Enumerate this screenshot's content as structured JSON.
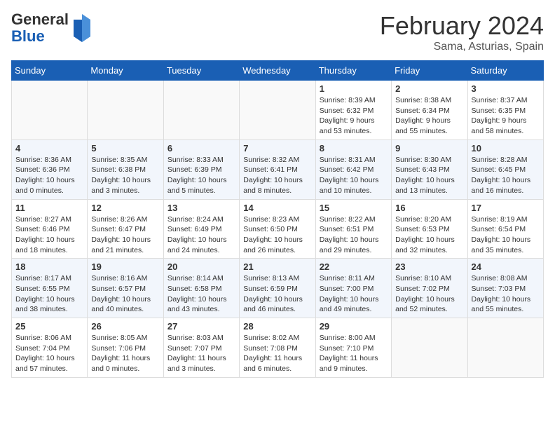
{
  "header": {
    "logo_general": "General",
    "logo_blue": "Blue",
    "month": "February 2024",
    "location": "Sama, Asturias, Spain"
  },
  "weekdays": [
    "Sunday",
    "Monday",
    "Tuesday",
    "Wednesday",
    "Thursday",
    "Friday",
    "Saturday"
  ],
  "weeks": [
    [
      {
        "day": "",
        "info": ""
      },
      {
        "day": "",
        "info": ""
      },
      {
        "day": "",
        "info": ""
      },
      {
        "day": "",
        "info": ""
      },
      {
        "day": "1",
        "info": "Sunrise: 8:39 AM\nSunset: 6:32 PM\nDaylight: 9 hours\nand 53 minutes."
      },
      {
        "day": "2",
        "info": "Sunrise: 8:38 AM\nSunset: 6:34 PM\nDaylight: 9 hours\nand 55 minutes."
      },
      {
        "day": "3",
        "info": "Sunrise: 8:37 AM\nSunset: 6:35 PM\nDaylight: 9 hours\nand 58 minutes."
      }
    ],
    [
      {
        "day": "4",
        "info": "Sunrise: 8:36 AM\nSunset: 6:36 PM\nDaylight: 10 hours\nand 0 minutes."
      },
      {
        "day": "5",
        "info": "Sunrise: 8:35 AM\nSunset: 6:38 PM\nDaylight: 10 hours\nand 3 minutes."
      },
      {
        "day": "6",
        "info": "Sunrise: 8:33 AM\nSunset: 6:39 PM\nDaylight: 10 hours\nand 5 minutes."
      },
      {
        "day": "7",
        "info": "Sunrise: 8:32 AM\nSunset: 6:41 PM\nDaylight: 10 hours\nand 8 minutes."
      },
      {
        "day": "8",
        "info": "Sunrise: 8:31 AM\nSunset: 6:42 PM\nDaylight: 10 hours\nand 10 minutes."
      },
      {
        "day": "9",
        "info": "Sunrise: 8:30 AM\nSunset: 6:43 PM\nDaylight: 10 hours\nand 13 minutes."
      },
      {
        "day": "10",
        "info": "Sunrise: 8:28 AM\nSunset: 6:45 PM\nDaylight: 10 hours\nand 16 minutes."
      }
    ],
    [
      {
        "day": "11",
        "info": "Sunrise: 8:27 AM\nSunset: 6:46 PM\nDaylight: 10 hours\nand 18 minutes."
      },
      {
        "day": "12",
        "info": "Sunrise: 8:26 AM\nSunset: 6:47 PM\nDaylight: 10 hours\nand 21 minutes."
      },
      {
        "day": "13",
        "info": "Sunrise: 8:24 AM\nSunset: 6:49 PM\nDaylight: 10 hours\nand 24 minutes."
      },
      {
        "day": "14",
        "info": "Sunrise: 8:23 AM\nSunset: 6:50 PM\nDaylight: 10 hours\nand 26 minutes."
      },
      {
        "day": "15",
        "info": "Sunrise: 8:22 AM\nSunset: 6:51 PM\nDaylight: 10 hours\nand 29 minutes."
      },
      {
        "day": "16",
        "info": "Sunrise: 8:20 AM\nSunset: 6:53 PM\nDaylight: 10 hours\nand 32 minutes."
      },
      {
        "day": "17",
        "info": "Sunrise: 8:19 AM\nSunset: 6:54 PM\nDaylight: 10 hours\nand 35 minutes."
      }
    ],
    [
      {
        "day": "18",
        "info": "Sunrise: 8:17 AM\nSunset: 6:55 PM\nDaylight: 10 hours\nand 38 minutes."
      },
      {
        "day": "19",
        "info": "Sunrise: 8:16 AM\nSunset: 6:57 PM\nDaylight: 10 hours\nand 40 minutes."
      },
      {
        "day": "20",
        "info": "Sunrise: 8:14 AM\nSunset: 6:58 PM\nDaylight: 10 hours\nand 43 minutes."
      },
      {
        "day": "21",
        "info": "Sunrise: 8:13 AM\nSunset: 6:59 PM\nDaylight: 10 hours\nand 46 minutes."
      },
      {
        "day": "22",
        "info": "Sunrise: 8:11 AM\nSunset: 7:00 PM\nDaylight: 10 hours\nand 49 minutes."
      },
      {
        "day": "23",
        "info": "Sunrise: 8:10 AM\nSunset: 7:02 PM\nDaylight: 10 hours\nand 52 minutes."
      },
      {
        "day": "24",
        "info": "Sunrise: 8:08 AM\nSunset: 7:03 PM\nDaylight: 10 hours\nand 55 minutes."
      }
    ],
    [
      {
        "day": "25",
        "info": "Sunrise: 8:06 AM\nSunset: 7:04 PM\nDaylight: 10 hours\nand 57 minutes."
      },
      {
        "day": "26",
        "info": "Sunrise: 8:05 AM\nSunset: 7:06 PM\nDaylight: 11 hours\nand 0 minutes."
      },
      {
        "day": "27",
        "info": "Sunrise: 8:03 AM\nSunset: 7:07 PM\nDaylight: 11 hours\nand 3 minutes."
      },
      {
        "day": "28",
        "info": "Sunrise: 8:02 AM\nSunset: 7:08 PM\nDaylight: 11 hours\nand 6 minutes."
      },
      {
        "day": "29",
        "info": "Sunrise: 8:00 AM\nSunset: 7:10 PM\nDaylight: 11 hours\nand 9 minutes."
      },
      {
        "day": "",
        "info": ""
      },
      {
        "day": "",
        "info": ""
      }
    ]
  ]
}
